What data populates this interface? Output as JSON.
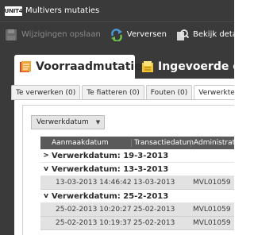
{
  "window": {
    "logo_text": "UNIT4",
    "title": "Multivers mutaties"
  },
  "toolbar": {
    "save_label": "Wijzigingen opslaan",
    "refresh_label": "Verversen",
    "view_label": "Bekijk deta"
  },
  "main_tabs": [
    {
      "label": "Voorraadmutaties",
      "icon": "inventory-icon",
      "active": true
    },
    {
      "label": "Ingevoerde ord",
      "icon": "entered-orders-icon",
      "active": false
    }
  ],
  "sub_tabs": [
    {
      "label": "Te verwerken (0)"
    },
    {
      "label": "Te fiatteren (0)"
    },
    {
      "label": "Fouten (0)"
    },
    {
      "label": "Verwerkte"
    }
  ],
  "group_by": {
    "label": "Verwerkdatum"
  },
  "grid": {
    "columns": [
      "Aanmaakdatum",
      "Transactiedatum",
      "Administratie"
    ],
    "groups": [
      {
        "label": "Verwerkdatum: 19-3-2013",
        "expanded": false,
        "rows": []
      },
      {
        "label": "Verwerkdatum: 13-3-2013",
        "expanded": true,
        "rows": [
          [
            "13-03-2013 14:46:42",
            "13-03-2013",
            "MVL01059"
          ]
        ]
      },
      {
        "label": "Verwerkdatum: 25-2-2013",
        "expanded": true,
        "rows": [
          [
            "25-02-2013 10:20:27",
            "25-02-2013",
            "MVL01059"
          ],
          [
            "25-02-2013 10:19:37",
            "25-02-2013",
            "MVL01059"
          ]
        ]
      }
    ]
  },
  "colors": {
    "chrome_dark": "#3a3a3a",
    "grid_header": "#5a5a5a",
    "row_shade": "#e2e2e2"
  }
}
